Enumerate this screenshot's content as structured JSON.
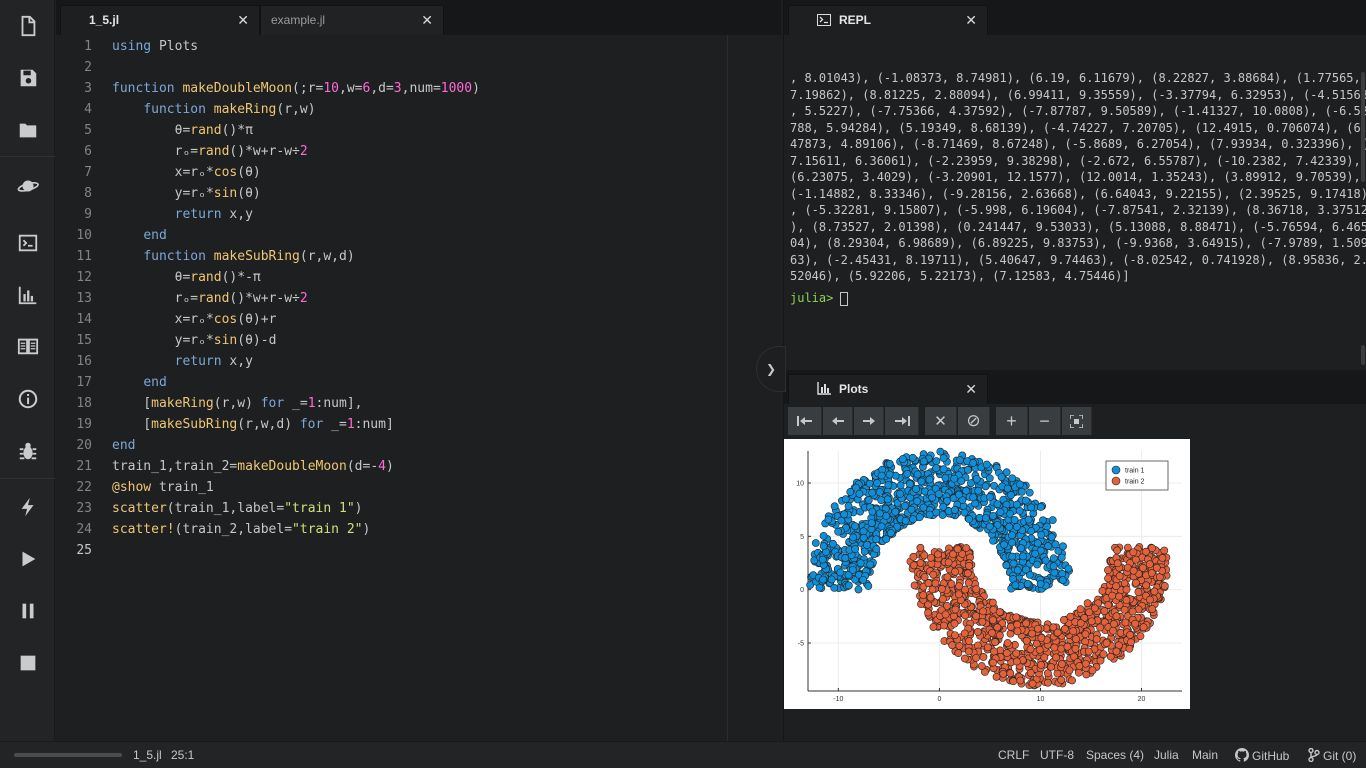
{
  "toolbar": {
    "items": [
      "new-file",
      "save",
      "open-folder",
      "planet",
      "terminal",
      "plots",
      "documentation",
      "info",
      "debug",
      "run-file",
      "run",
      "pause",
      "stop"
    ]
  },
  "editor": {
    "tabs": [
      {
        "label": "1_5.jl",
        "close": "✕"
      },
      {
        "label": "example.jl",
        "close": "✕"
      }
    ],
    "line_numbers": [
      "1",
      "2",
      "3",
      "4",
      "5",
      "6",
      "7",
      "8",
      "9",
      "10",
      "11",
      "12",
      "13",
      "14",
      "15",
      "16",
      "17",
      "18",
      "19",
      "20",
      "21",
      "22",
      "23",
      "24",
      "25"
    ],
    "current_line": "25",
    "lines": [
      "using Plots",
      "",
      "function makeDoubleMoon(;r=10,w=6,d=3,num=1000)",
      "    function makeRing(r,w)",
      "        θ=rand()*π",
      "        rₒ=rand()*w+r-w÷2",
      "        x=rₒ*cos(θ)",
      "        y=rₒ*sin(θ)",
      "        return x,y",
      "    end",
      "    function makeSubRing(r,w,d)",
      "        θ=rand()*-π",
      "        rₒ=rand()*w+r-w÷2",
      "        x=rₒ*cos(θ)+r",
      "        y=rₒ*sin(θ)-d",
      "        return x,y",
      "    end",
      "    [makeRing(r,w) for _=1:num],",
      "    [makeSubRing(r,w,d) for _=1:num]",
      "end",
      "train_1,train_2=makeDoubleMoon(d=-4)",
      "@show train_1",
      "scatter(train_1,label=\"train 1\")",
      "scatter!(train_2,label=\"train 2\")",
      ""
    ]
  },
  "repl": {
    "tab_label": "REPL",
    "tab_close": "✕",
    "output": ", 8.01043), (-1.08373, 8.74981), (6.19, 6.11679), (8.22827, 3.88684), (1.77565,\n7.19862), (8.81225, 2.88094), (6.99411, 9.35559), (-3.37794, 6.32953), (-4.51563\n, 5.5227), (-7.75366, 4.37592), (-7.87787, 9.50589), (-1.41327, 10.0808), (-6.52\n788, 5.94284), (5.19349, 8.68139), (-4.74227, 7.20705), (12.4915, 0.706074), (6.\n47873, 4.89106), (-8.71469, 8.67248), (-5.8689, 6.27054), (7.93934, 0.323396), (\n7.15611, 6.36061), (-2.23959, 9.38298), (-2.672, 6.55787), (-10.2382, 7.42339),\n(6.23075, 3.4029), (-3.20901, 12.1577), (12.0014, 1.35243), (3.89912, 9.70539),\n(-1.14882, 8.33346), (-9.28156, 2.63668), (6.64043, 9.22155), (2.39525, 9.17418)\n, (-5.32281, 9.15807), (-5.998, 6.19604), (-7.87541, 2.32139), (8.36718, 3.37512\n), (8.73527, 2.01398), (0.241447, 9.53033), (5.13088, 8.88471), (-5.76594, 6.465\n04), (8.29304, 6.98689), (6.89225, 9.83753), (-9.9368, 3.64915), (-7.9789, 1.509\n63), (-2.45431, 8.19711), (5.40647, 9.74463), (-8.02542, 0.741928), (8.95836, 2.\n52046), (5.92206, 5.22173), (7.12583, 4.75446)]",
    "prompt": "julia>"
  },
  "plots": {
    "tab_label": "Plots",
    "tab_close": "✕",
    "buttons": [
      "first-plot",
      "previous-plot",
      "next-plot",
      "last-plot",
      "delete-plot",
      "clear-plots",
      "zoom-in",
      "zoom-out",
      "fit-plot"
    ],
    "button_glyphs": {
      "delete": "✕",
      "clear": "⊘",
      "zoom_in": "+",
      "zoom_out": "−"
    }
  },
  "chart_data": {
    "type": "scatter",
    "title": "",
    "xlabel": "",
    "ylabel": "",
    "xlim": [
      -13,
      24
    ],
    "ylim": [
      -9.5,
      13
    ],
    "xticks": [
      "-10",
      "0",
      "10",
      "20"
    ],
    "xtick_values": [
      -10,
      0,
      10,
      20
    ],
    "yticks": [
      "10",
      "5",
      "0",
      "-5"
    ],
    "ytick_values": [
      10,
      5,
      0,
      -5
    ],
    "grid": true,
    "legend_position": "top-right",
    "series": [
      {
        "name": "train 1",
        "color": "#0f8fd9",
        "kind": "upper half-ring, center (0,0), radius 7 to 13, angle 0 to π",
        "points": [
          [
            -1.08373,
            8.74981
          ],
          [
            6.19,
            6.11679
          ],
          [
            8.22827,
            3.88684
          ],
          [
            1.77565,
            7.19862
          ],
          [
            8.81225,
            2.88094
          ],
          [
            6.99411,
            9.35559
          ],
          [
            -3.37794,
            6.32953
          ],
          [
            -4.51563,
            5.5227
          ],
          [
            -7.75366,
            4.37592
          ],
          [
            -7.87787,
            9.50589
          ],
          [
            -1.41327,
            10.0808
          ],
          [
            -6.52788,
            5.94284
          ],
          [
            5.19349,
            8.68139
          ],
          [
            -4.74227,
            7.20705
          ],
          [
            12.4915,
            0.706074
          ],
          [
            6.47873,
            4.89106
          ],
          [
            -8.71469,
            8.67248
          ],
          [
            -5.8689,
            6.27054
          ],
          [
            7.93934,
            0.323396
          ],
          [
            7.15611,
            6.36061
          ],
          [
            -2.23959,
            9.38298
          ],
          [
            -2.672,
            6.55787
          ],
          [
            -10.2382,
            7.42339
          ],
          [
            6.23075,
            3.4029
          ],
          [
            -3.20901,
            12.1577
          ],
          [
            12.0014,
            1.35243
          ],
          [
            3.89912,
            9.70539
          ],
          [
            -1.14882,
            8.33346
          ],
          [
            -9.28156,
            2.63668
          ],
          [
            6.64043,
            9.22155
          ],
          [
            2.39525,
            9.17418
          ],
          [
            -5.32281,
            9.15807
          ],
          [
            -5.998,
            6.19604
          ],
          [
            -7.87541,
            2.32139
          ],
          [
            8.36718,
            3.37512
          ],
          [
            8.73527,
            2.01398
          ],
          [
            0.241447,
            9.53033
          ],
          [
            5.13088,
            8.88471
          ],
          [
            -5.76594,
            6.46504
          ],
          [
            8.29304,
            6.98689
          ],
          [
            6.89225,
            9.83753
          ],
          [
            -9.9368,
            3.64915
          ],
          [
            -7.9789,
            1.50963
          ],
          [
            -2.45431,
            8.19711
          ],
          [
            5.40647,
            9.74463
          ],
          [
            -8.02542,
            0.741928
          ],
          [
            8.95836,
            2.52046
          ],
          [
            5.92206,
            5.22173
          ],
          [
            7.12583,
            4.75446
          ]
        ]
      },
      {
        "name": "train 2",
        "color": "#e3623b",
        "kind": "lower half-ring, center (10,4), radius 7 to 13, angle 0 to -π",
        "points": []
      }
    ]
  },
  "status": {
    "file": "1_5.jl",
    "cursor": "25:1",
    "line_ending": "CRLF",
    "encoding": "UTF-8",
    "indent": "Spaces (4)",
    "grammar": "Julia",
    "module": "Main",
    "github": "GitHub",
    "git": "Git (0)"
  }
}
